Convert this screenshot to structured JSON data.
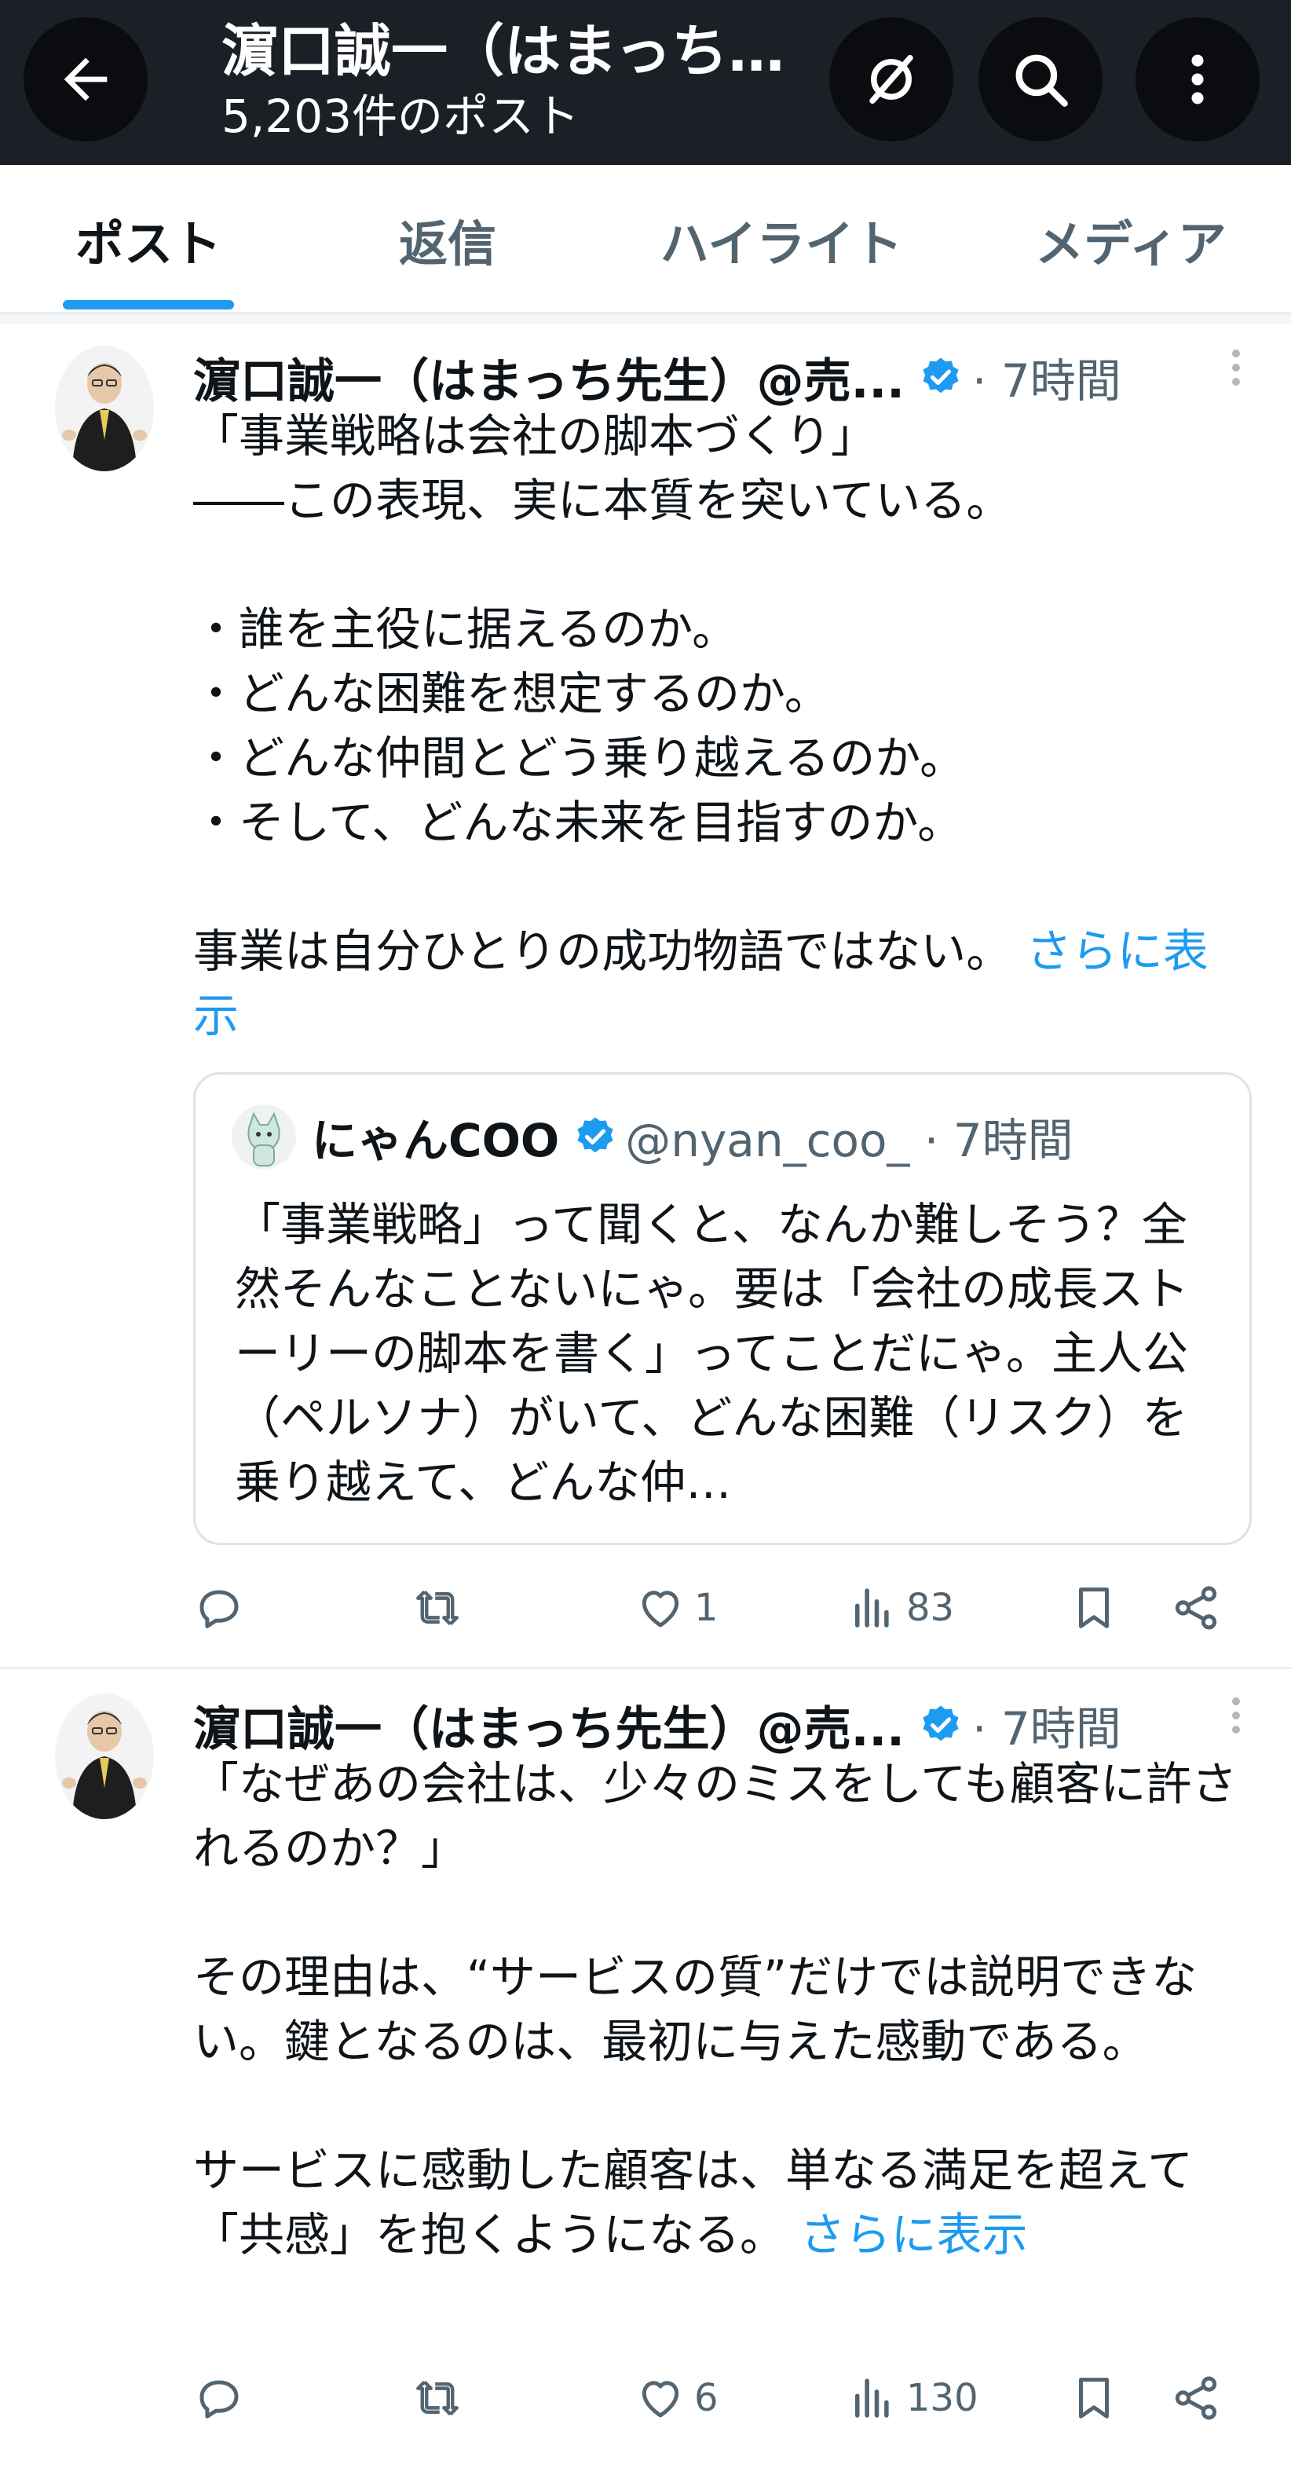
{
  "header": {
    "title": "濵口誠一（はまっち先生）@売れる理由を科学するマーケティング",
    "post_count": "5,203件のポスト"
  },
  "tabs": [
    {
      "label": "ポスト",
      "active": true
    },
    {
      "label": "返信",
      "active": false
    },
    {
      "label": "ハイライト",
      "active": false
    },
    {
      "label": "メディア",
      "active": false
    }
  ],
  "posts": [
    {
      "author_name": "濵口誠一（はまっち先生）@売...",
      "time": "· 7時間",
      "body": "「事業戦略は会社の脚本づくり」\n――この表現、実に本質を突いている。\n\n・誰を主役に据えるのか。\n・どんな困難を想定するのか。\n・どんな仲間とどう乗り越えるのか。\n・そして、どんな未来を目指すのか。\n\n事業は自分ひとりの成功物語ではない。",
      "show_more": "さらに表示",
      "quote": {
        "name": "にゃんCOO",
        "handle": "@nyan_coo_ · 7時間",
        "body": "「事業戦略」って聞くと、なんか難しそう？全然そんなことないにゃ。要は「会社の成長ストーリーの脚本を書く」ってことだにゃ。主人公（ペルソナ）がいて、どんな困難（リスク）を乗り越えて、どんな仲…"
      },
      "likes": "1",
      "views": "83"
    },
    {
      "author_name": "濵口誠一（はまっち先生）@売...",
      "time": "· 7時間",
      "body": "「なぜあの会社は、少々のミスをしても顧客に許されるのか？」\n\nその理由は、“サービスの質”だけでは説明できない。鍵となるのは、最初に与えた感動である。\n\nサービスに感動した顧客は、単なる満足を超えて「共感」を抱くようになる。",
      "show_more": "さらに表示",
      "likes": "6",
      "views": "130"
    }
  ],
  "colors": {
    "header_bg": "#1b2027",
    "accent": "#1d9bf0",
    "muted": "#536471"
  },
  "icons": [
    "back-arrow-icon",
    "translate-icon",
    "search-icon",
    "more-vertical-icon",
    "verified-badge-icon",
    "reply-icon",
    "repost-icon",
    "like-icon",
    "views-icon",
    "bookmark-icon",
    "share-icon"
  ]
}
